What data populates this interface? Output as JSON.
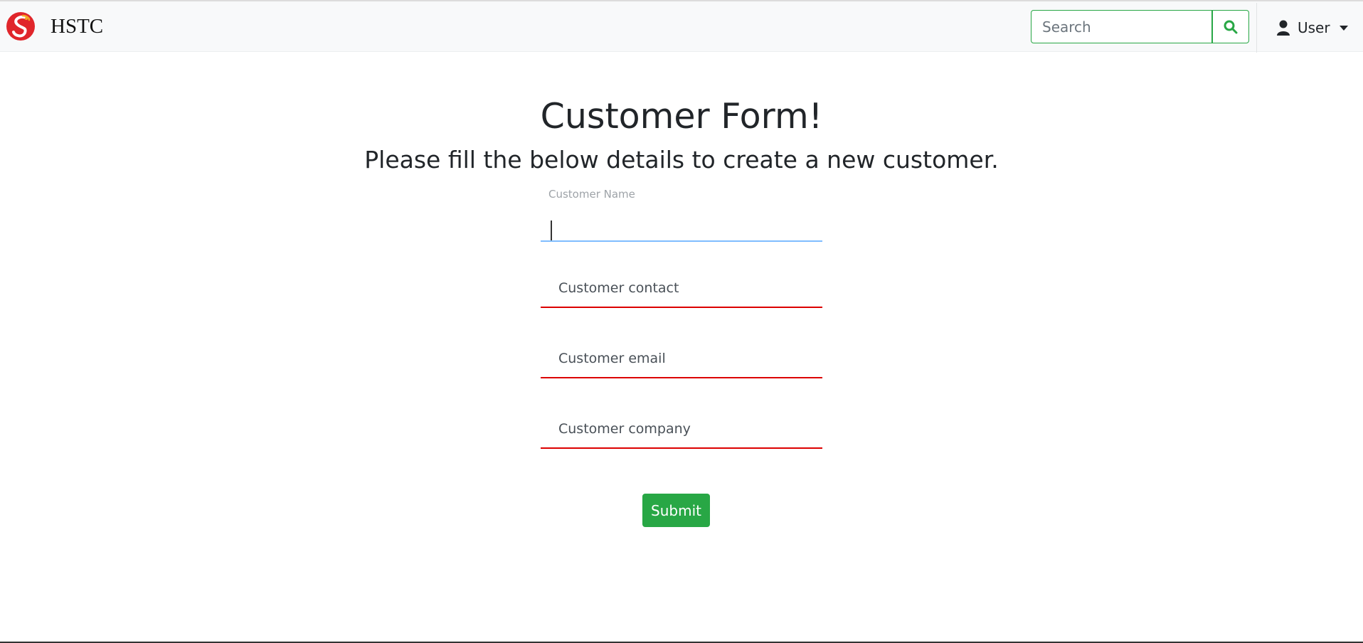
{
  "navbar": {
    "brand": "HSTC",
    "search_placeholder": "Search",
    "search_icon": "search-icon",
    "user_label": "User",
    "user_icon": "user-icon"
  },
  "main": {
    "title": "Customer Form!",
    "subtitle": "Please fill the below details to create a new customer."
  },
  "form": {
    "customer_name": {
      "label": "Customer Name",
      "value": ""
    },
    "customer_contact": {
      "placeholder": "Customer contact"
    },
    "customer_email": {
      "placeholder": "Customer email"
    },
    "customer_company": {
      "placeholder": "Customer company"
    },
    "submit_label": "Submit"
  },
  "colors": {
    "accent": "#28a745",
    "invalid": "#dc0000",
    "focus": "#80bdff",
    "logo": "#e0262b"
  }
}
